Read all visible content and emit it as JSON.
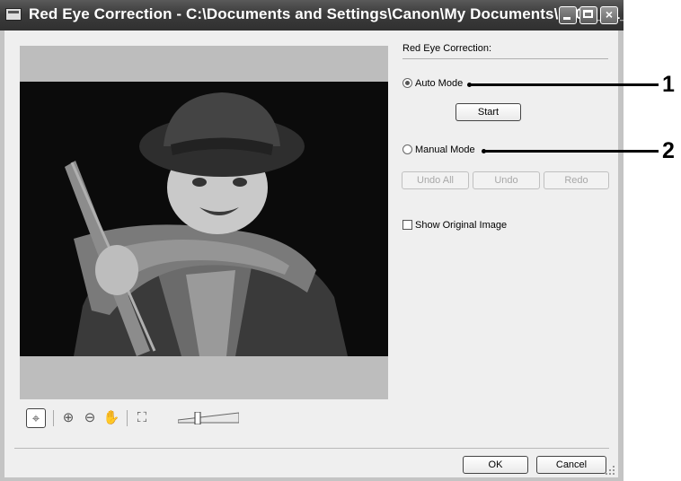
{
  "window": {
    "title": "Red Eye Correction - C:\\Documents and Settings\\Canon\\My Documents\\200X_01_15\\IMG_...",
    "controls": {
      "minimize": "minimize",
      "maximize": "maximize",
      "close": "×"
    }
  },
  "panel": {
    "section_title": "Red Eye Correction:",
    "auto_mode_label": "Auto Mode",
    "auto_mode_selected": true,
    "start_label": "Start",
    "manual_mode_label": "Manual Mode",
    "manual_mode_selected": false,
    "undo_all_label": "Undo All",
    "undo_label": "Undo",
    "redo_label": "Redo",
    "show_original_label": "Show Original Image",
    "show_original_checked": false
  },
  "toolbar": {
    "tools": [
      {
        "name": "select-tool-icon",
        "glyph": "⌖",
        "selected": true
      },
      {
        "name": "zoom-in-icon",
        "glyph": "⊕"
      },
      {
        "name": "zoom-out-icon",
        "glyph": "⊖"
      },
      {
        "name": "hand-pan-icon",
        "glyph": "✋"
      },
      {
        "name": "fit-to-window-icon",
        "glyph": "⛶"
      }
    ],
    "zoom_slider_value": 0.3
  },
  "footer": {
    "ok_label": "OK",
    "cancel_label": "Cancel"
  },
  "callouts": [
    {
      "number": "1"
    },
    {
      "number": "2"
    }
  ],
  "colors": {
    "titlebar": "#3c3c3c",
    "client": "#efefef",
    "frame": "#c4c4c4"
  }
}
